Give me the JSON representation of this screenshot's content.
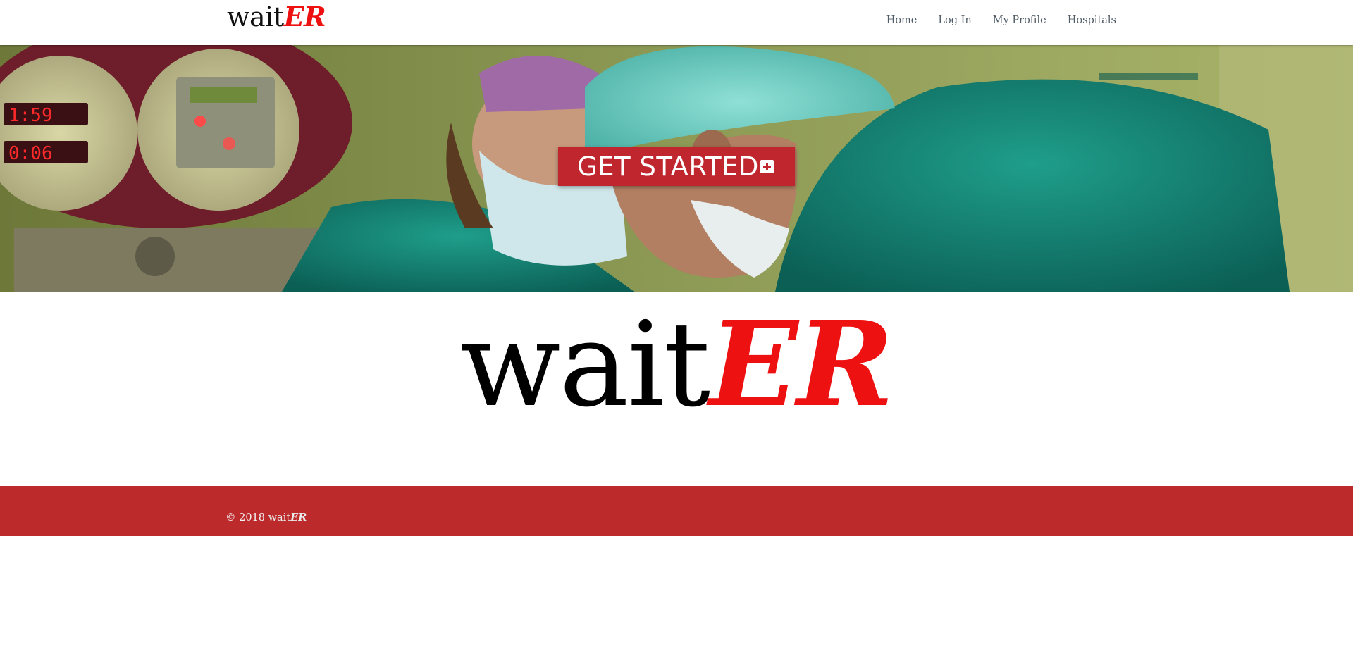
{
  "brand": {
    "name_prefix": "wait",
    "name_suffix": "ER"
  },
  "nav": {
    "items": [
      {
        "label": "Home"
      },
      {
        "label": "Log In"
      },
      {
        "label": "My Profile"
      },
      {
        "label": "Hospitals"
      }
    ]
  },
  "hero": {
    "cta_label": "GET STARTED",
    "cta_icon": "plus-square-icon",
    "image": "surgeons-operating-room-photo"
  },
  "logo": {
    "prefix": "wait",
    "suffix": "ER"
  },
  "footer": {
    "copyright_symbol": "©",
    "year": "2018",
    "brand_prefix": "wait",
    "brand_suffix": "ER"
  },
  "colors": {
    "accent_red": "#ee1111",
    "button_red": "#c0262d",
    "footer_red": "#bc2a2c",
    "nav_text": "#4f5b66"
  }
}
